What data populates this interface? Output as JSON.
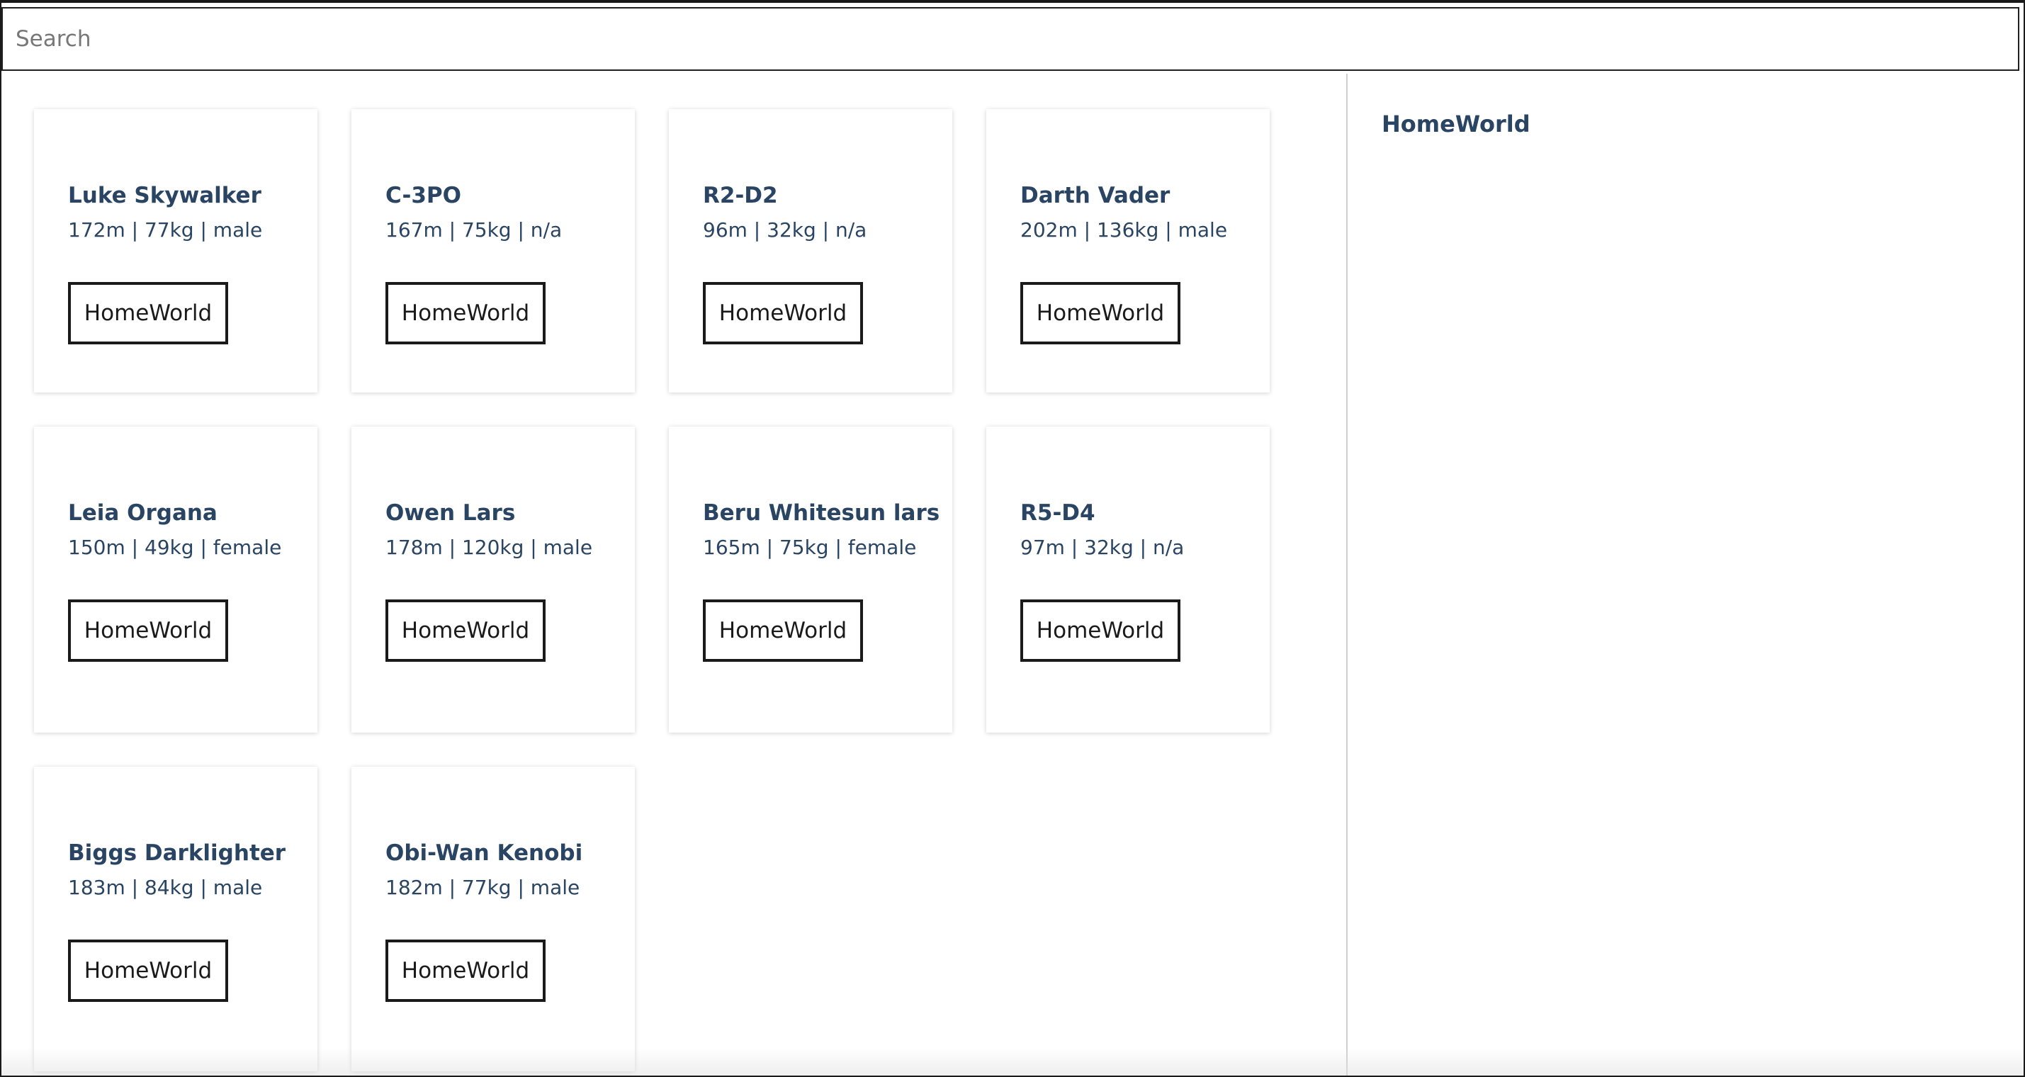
{
  "search": {
    "placeholder": "Search",
    "value": ""
  },
  "cards": [
    {
      "name": "Luke Skywalker",
      "stats": "172m | 77kg | male",
      "button_label": "HomeWorld"
    },
    {
      "name": "C-3PO",
      "stats": "167m | 75kg | n/a",
      "button_label": "HomeWorld"
    },
    {
      "name": "R2-D2",
      "stats": "96m | 32kg | n/a",
      "button_label": "HomeWorld"
    },
    {
      "name": "Darth Vader",
      "stats": "202m | 136kg | male",
      "button_label": "HomeWorld"
    },
    {
      "name": "Leia Organa",
      "stats": "150m | 49kg | female",
      "button_label": "HomeWorld"
    },
    {
      "name": "Owen Lars",
      "stats": "178m | 120kg | male",
      "button_label": "HomeWorld"
    },
    {
      "name": "Beru Whitesun lars",
      "stats": "165m | 75kg | female",
      "button_label": "HomeWorld"
    },
    {
      "name": "R5-D4",
      "stats": "97m | 32kg | n/a",
      "button_label": "HomeWorld"
    },
    {
      "name": "Biggs Darklighter",
      "stats": "183m | 84kg | male",
      "button_label": "HomeWorld"
    },
    {
      "name": "Obi-Wan Kenobi",
      "stats": "182m | 77kg | male",
      "button_label": "HomeWorld"
    }
  ],
  "side_panel": {
    "title": "HomeWorld"
  },
  "colors": {
    "heading_text": "#2a4563",
    "button_border": "#1a1a1a",
    "divider": "#cfcfcf"
  }
}
